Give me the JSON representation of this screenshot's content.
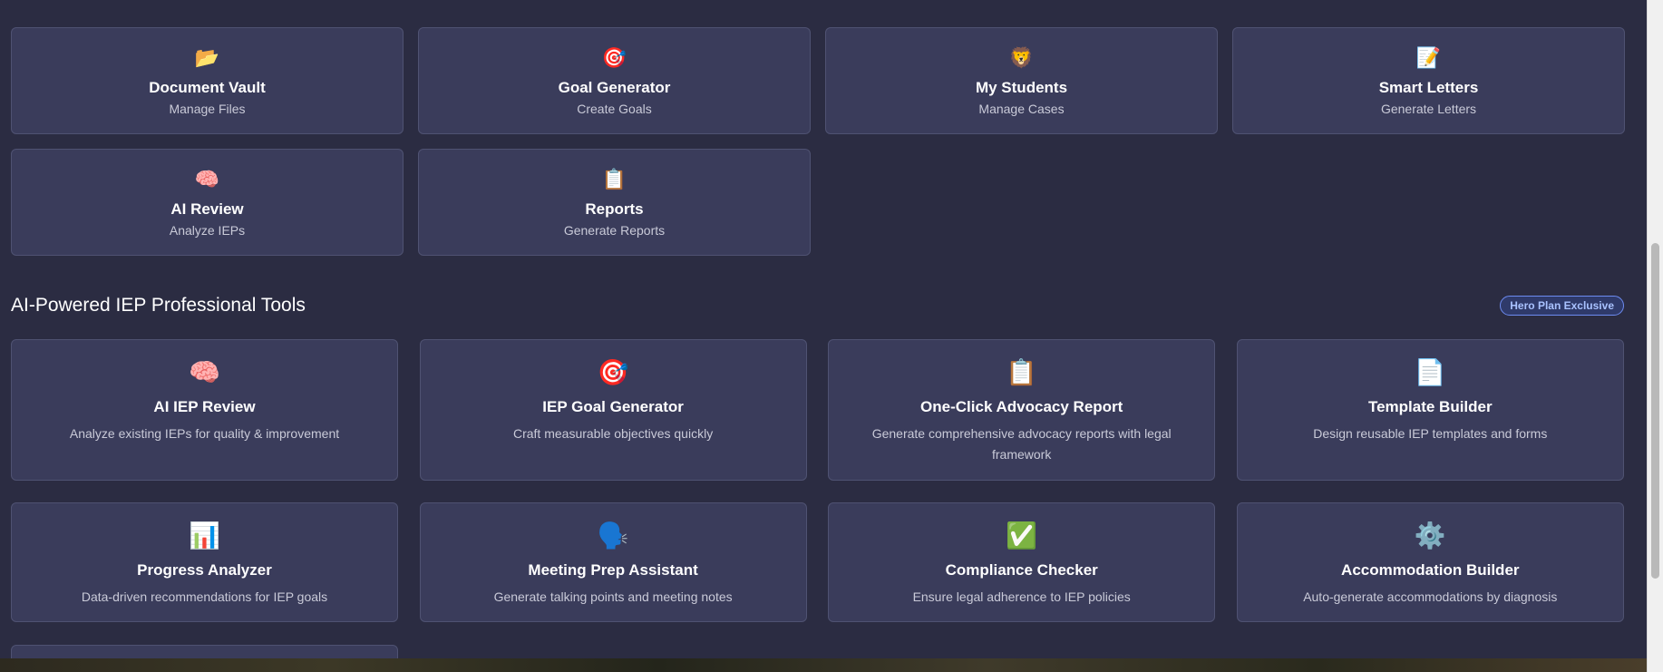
{
  "quick_links": [
    {
      "icon": "📂",
      "title": "Document Vault",
      "subtitle": "Manage Files"
    },
    {
      "icon": "🎯",
      "title": "Goal Generator",
      "subtitle": "Create Goals"
    },
    {
      "icon": "🦁",
      "title": "My Students",
      "subtitle": "Manage Cases"
    },
    {
      "icon": "📝",
      "title": "Smart Letters",
      "subtitle": "Generate Letters"
    },
    {
      "icon": "🧠",
      "title": "AI Review",
      "subtitle": "Analyze IEPs"
    },
    {
      "icon": "📋",
      "title": "Reports",
      "subtitle": "Generate Reports"
    }
  ],
  "tools_section": {
    "title": "AI-Powered IEP Professional Tools",
    "badge": "Hero Plan Exclusive"
  },
  "tools": [
    {
      "icon": "🧠",
      "title": "AI IEP Review",
      "description": "Analyze existing IEPs for quality & improvement"
    },
    {
      "icon": "🎯",
      "title": "IEP Goal Generator",
      "description": "Craft measurable objectives quickly"
    },
    {
      "icon": "📋",
      "title": "One-Click Advocacy Report",
      "description": "Generate comprehensive advocacy reports with legal framework"
    },
    {
      "icon": "📄",
      "title": "Template Builder",
      "description": "Design reusable IEP templates and forms"
    },
    {
      "icon": "📊",
      "title": "Progress Analyzer",
      "description": "Data-driven recommendations for IEP goals"
    },
    {
      "icon": "🗣️",
      "title": "Meeting Prep Assistant",
      "description": "Generate talking points and meeting notes"
    },
    {
      "icon": "✅",
      "title": "Compliance Checker",
      "description": "Ensure legal adherence to IEP policies"
    },
    {
      "icon": "⚙️",
      "title": "Accommodation Builder",
      "description": "Auto-generate accommodations by diagnosis"
    }
  ]
}
